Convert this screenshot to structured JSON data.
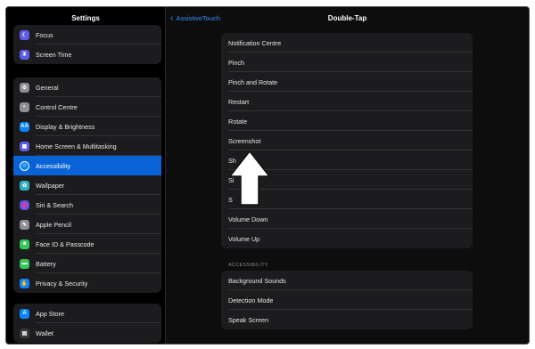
{
  "sidebar": {
    "title": "Settings",
    "group1": [
      {
        "label": "Focus",
        "icon": "moon-icon",
        "color": "#5e5ce6"
      },
      {
        "label": "Screen Time",
        "icon": "hourglass-icon",
        "color": "#5e5ce6"
      }
    ],
    "group2": [
      {
        "label": "General",
        "icon": "gear-icon",
        "color": "#8e8e93"
      },
      {
        "label": "Control Centre",
        "icon": "toggles-icon",
        "color": "#8e8e93"
      },
      {
        "label": "Display & Brightness",
        "icon": "aa-icon",
        "color": "#0a84ff"
      },
      {
        "label": "Home Screen & Multitasking",
        "icon": "grid-icon",
        "color": "#5e5ce6"
      },
      {
        "label": "Accessibility",
        "icon": "accessibility-icon",
        "color": "#0a84ff"
      },
      {
        "label": "Wallpaper",
        "icon": "flower-icon",
        "color": "#30b0c7"
      },
      {
        "label": "Siri & Search",
        "icon": "siri-icon",
        "color": "#1c1c1e"
      },
      {
        "label": "Apple Pencil",
        "icon": "pencil-icon",
        "color": "#8e8e93"
      },
      {
        "label": "Face ID & Passcode",
        "icon": "faceid-icon",
        "color": "#34c759"
      },
      {
        "label": "Battery",
        "icon": "battery-icon",
        "color": "#34c759"
      },
      {
        "label": "Privacy & Security",
        "icon": "hand-icon",
        "color": "#0a84ff"
      }
    ],
    "group3": [
      {
        "label": "App Store",
        "icon": "appstore-icon",
        "color": "#0a84ff"
      },
      {
        "label": "Wallet",
        "icon": "wallet-icon",
        "color": "#3a3a3c"
      }
    ]
  },
  "main": {
    "back_label": "AssistiveTouch",
    "title": "Double-Tap",
    "options": [
      "Notification Centre",
      "Pinch",
      "Pinch and Rotate",
      "Restart",
      "Rotate",
      "Screenshot",
      "Sh",
      "Si",
      "S",
      "Volume Down",
      "Volume Up"
    ],
    "section_header": "ACCESSIBILITY",
    "accessibility_options": [
      "Background Sounds",
      "Detection Mode",
      "Speak Screen"
    ]
  }
}
